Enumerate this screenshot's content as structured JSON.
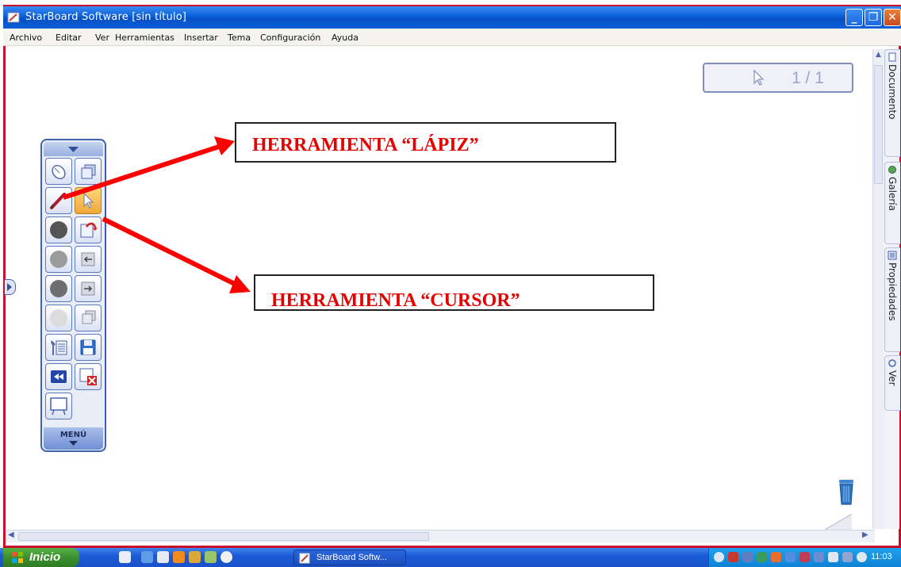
{
  "window": {
    "title": "StarBoard Software [sin título]",
    "min_icon": "minimize-icon",
    "max_icon": "maximize-icon",
    "close_icon": "close-icon"
  },
  "menu": [
    "Archivo",
    "Editar",
    "Ver",
    "Herramientas",
    "Insertar",
    "Tema",
    "Configuración",
    "Ayuda"
  ],
  "page_indicator": {
    "value": "1 / 1"
  },
  "side_tabs": [
    "Documento",
    "Galería",
    "Propiedades",
    "Ver"
  ],
  "toolbar": {
    "menu_label": "MENÚ",
    "tools": [
      {
        "icon": "mouse-icon"
      },
      {
        "icon": "layers-icon"
      },
      {
        "icon": "pen-icon"
      },
      {
        "icon": "cursor-icon",
        "selected": true
      },
      {
        "icon": "black-ink-icon"
      },
      {
        "icon": "page-export-icon"
      },
      {
        "icon": "gray-ink-icon"
      },
      {
        "icon": "previous-page-icon"
      },
      {
        "icon": "dark-ink-icon"
      },
      {
        "icon": "next-page-icon"
      },
      {
        "icon": "light-ink-icon"
      },
      {
        "icon": "pages-icon"
      },
      {
        "icon": "settings-list-icon"
      },
      {
        "icon": "save-icon"
      },
      {
        "icon": "rewind-icon"
      },
      {
        "icon": "close-page-icon"
      },
      {
        "icon": "whiteboard-icon"
      }
    ]
  },
  "callouts": {
    "pencil": "HERRAMIENTA  “LÁPIZ”",
    "cursor": "HERRAMIENTA “CURSOR”"
  },
  "colors": {
    "annotation_red": "#e60000",
    "arrow_red": "#ff0000",
    "frame_red": "#c8102e",
    "titlebar_blue": "#0a5fd8"
  },
  "taskbar": {
    "start_label": "Inicio",
    "task_label": "StarBoard Softw...",
    "clock": "11:03"
  }
}
